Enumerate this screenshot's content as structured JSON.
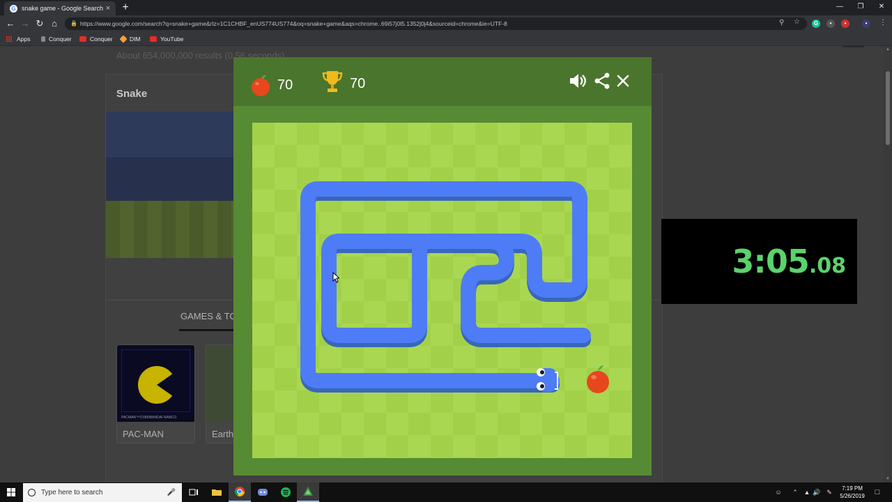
{
  "browser": {
    "tab_title": "snake game - Google Search",
    "tab_close": "×",
    "new_tab": "+",
    "url": "https://www.google.com/search?q=snake+game&rlz=1C1CHBF_enUS774US774&oq=snake+game&aqs=chrome..69i57j0l5.1352j0j4&sourceid=chrome&ie=UTF-8",
    "bookmarks": [
      {
        "label": "Apps",
        "icon": "apps-grid-icon"
      },
      {
        "label": "Conquer",
        "icon": "bookmark-icon"
      },
      {
        "label": "Conquer",
        "icon": "youtube-icon"
      },
      {
        "label": "DIM",
        "icon": "dim-icon"
      },
      {
        "label": "YouTube",
        "icon": "youtube-icon"
      }
    ]
  },
  "page": {
    "results_count": "About 654,000,000 results (0.56 seconds)",
    "knowledge_title": "Snake",
    "games_tab": "GAMES & TOYS",
    "games": [
      {
        "label": "PAC-MAN",
        "thumb_credit": "PACMAN™©1980BANDAI NAMCO"
      },
      {
        "label": "Earth"
      }
    ]
  },
  "snake_game": {
    "apple_score": "70",
    "trophy_score": "70",
    "icons": [
      "apple-icon",
      "trophy-icon",
      "sound-icon",
      "share-icon",
      "close-icon"
    ],
    "colors": {
      "panel": "#578a34",
      "header": "#4a752c",
      "board_light": "#aad751",
      "board_dark": "#a2d149",
      "snake": "#4e7cf6",
      "snake_dark": "#2b5bc7",
      "apple": "#e7471d"
    }
  },
  "timer": {
    "main": "3:05",
    "fraction": ".08",
    "color": "#5bd36c"
  },
  "taskbar": {
    "search_placeholder": "Type here to search",
    "time": "7:19 PM",
    "date": "5/26/2019"
  }
}
